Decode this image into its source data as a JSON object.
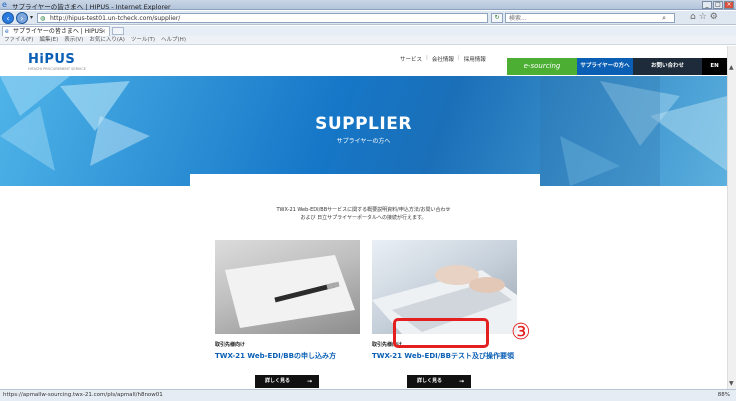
{
  "window": {
    "title": "サプライヤーの皆さまへ | HIPUS - Internet Explorer",
    "min": "_",
    "max": "□",
    "close": "×"
  },
  "addressbar": {
    "url": "http://hipus-test01.un-tcheck.com/supplier/",
    "search_placeholder": "検索..."
  },
  "tabs": [
    {
      "label": "サプライヤーの皆さまへ | HIPUS"
    }
  ],
  "menubar": [
    "ファイル(F)",
    "編集(E)",
    "表示(V)",
    "お気に入り(A)",
    "ツール(T)",
    "ヘルプ(H)"
  ],
  "site": {
    "logo": "HiPUS",
    "logo_sub": "HITACHI PROCUREMENT SERVICE",
    "nav": [
      "サービス",
      "会社情報",
      "採用情報"
    ],
    "esourcing": "e-sourcing",
    "supplier_btn": "サプライヤーの方へ",
    "contact_btn": "お問い合わせ",
    "lang_btn": "EN"
  },
  "hero": {
    "title": "SUPPLIER",
    "subtitle": "サプライヤーの方へ"
  },
  "intro": {
    "line1": "TWX-21 Web-EDI/BBサービスに関する概要説明資料/申込方法/お問い合わせ",
    "line2": "および 日立サプライヤーポータルへの接続が行えます。"
  },
  "cards": [
    {
      "kicker": "取引先様向け",
      "title": "TWX-21 Web-EDI/BBの申し込み方",
      "button": "詳しく見る"
    },
    {
      "kicker": "取引先様向け",
      "title": "TWX-21 Web-EDI/BBテスト及び操作要領",
      "button": "詳しく見る"
    }
  ],
  "annotation": "③",
  "status": {
    "url": "https://apmallw-sourcing.twx-21.com/pls/apmall/h8now01",
    "zoom": "88%"
  },
  "colors": {
    "brand_blue": "#0a5fb4",
    "esourcing_green": "#4caf34",
    "highlight_red": "#e41f1f"
  }
}
